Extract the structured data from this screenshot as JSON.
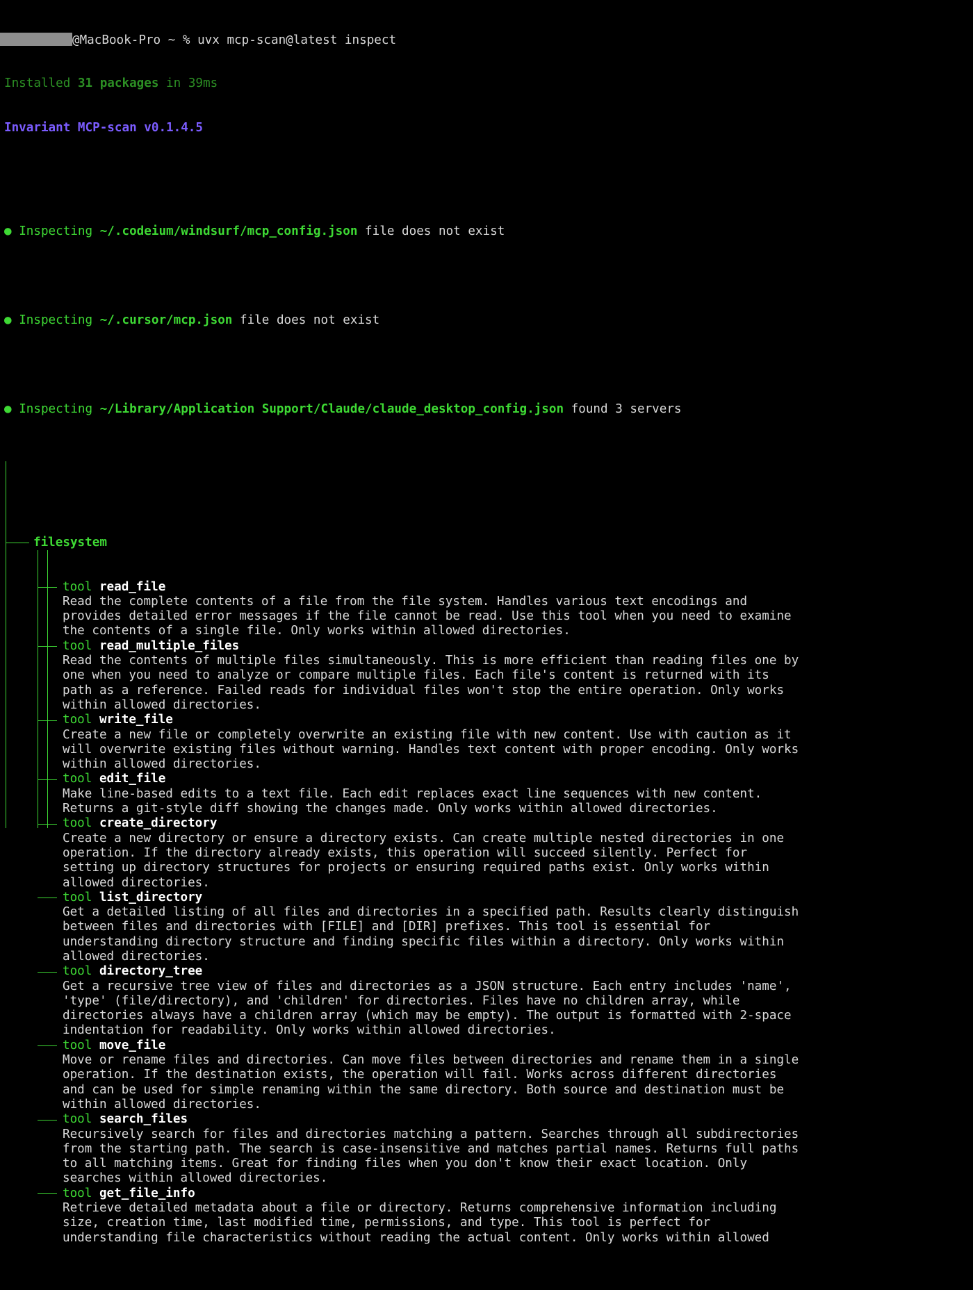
{
  "prompt": {
    "host": "@MacBook-Pro ~ % ",
    "command": "uvx mcp-scan@latest inspect"
  },
  "install_line": {
    "prefix": "Installed ",
    "count": "31 packages",
    "suffix": " in 39ms"
  },
  "version_line": "Invariant MCP-scan v0.1.4.5",
  "inspections": [
    {
      "bullet": "●",
      "label": "Inspecting",
      "path": "~/.codeium/windsurf/mcp_config.json",
      "status": "file does not exist"
    },
    {
      "bullet": "●",
      "label": "Inspecting",
      "path": "~/.cursor/mcp.json",
      "status": "file does not exist"
    },
    {
      "bullet": "●",
      "label": "Inspecting",
      "path": "~/Library/Application Support/Claude/claude_desktop_config.json",
      "status": "found 3 servers"
    }
  ],
  "server": {
    "name": "filesystem",
    "tool_keyword": "tool",
    "tools": [
      {
        "name": "read_file",
        "desc": [
          "Read the complete contents of a file from the file system. Handles various text encodings and",
          "provides detailed error messages if the file cannot be read. Use this tool when you need to examine",
          "the contents of a single file. Only works within allowed directories."
        ]
      },
      {
        "name": "read_multiple_files",
        "desc": [
          "Read the contents of multiple files simultaneously. This is more efficient than reading files one by",
          "one when you need to analyze or compare multiple files. Each file's content is returned with its",
          "path as a reference. Failed reads for individual files won't stop the entire operation. Only works",
          "within allowed directories."
        ]
      },
      {
        "name": "write_file",
        "desc": [
          "Create a new file or completely overwrite an existing file with new content. Use with caution as it",
          "will overwrite existing files without warning. Handles text content with proper encoding. Only works",
          "within allowed directories."
        ]
      },
      {
        "name": "edit_file",
        "desc": [
          "Make line-based edits to a text file. Each edit replaces exact line sequences with new content.",
          "Returns a git-style diff showing the changes made. Only works within allowed directories."
        ]
      },
      {
        "name": "create_directory",
        "desc": [
          "Create a new directory or ensure a directory exists. Can create multiple nested directories in one",
          "operation. If the directory already exists, this operation will succeed silently. Perfect for",
          "setting up directory structures for projects or ensuring required paths exist. Only works within",
          "allowed directories."
        ]
      },
      {
        "name": "list_directory",
        "desc": [
          "Get a detailed listing of all files and directories in a specified path. Results clearly distinguish",
          "between files and directories with [FILE] and [DIR] prefixes. This tool is essential for",
          "understanding directory structure and finding specific files within a directory. Only works within",
          "allowed directories."
        ]
      },
      {
        "name": "directory_tree",
        "desc": [
          "Get a recursive tree view of files and directories as a JSON structure. Each entry includes 'name',",
          "'type' (file/directory), and 'children' for directories. Files have no children array, while",
          "directories always have a children array (which may be empty). The output is formatted with 2-space",
          "indentation for readability. Only works within allowed directories."
        ]
      },
      {
        "name": "move_file",
        "desc": [
          "Move or rename files and directories. Can move files between directories and rename them in a single",
          "operation. If the destination exists, the operation will fail. Works across different directories",
          "and can be used for simple renaming within the same directory. Both source and destination must be",
          "within allowed directories."
        ]
      },
      {
        "name": "search_files",
        "desc": [
          "Recursively search for files and directories matching a pattern. Searches through all subdirectories",
          "from the starting path. The search is case-insensitive and matches partial names. Returns full paths",
          "to all matching items. Great for finding files when you don't know their exact location. Only",
          "searches within allowed directories."
        ]
      },
      {
        "name": "get_file_info",
        "desc": [
          "Retrieve detailed metadata about a file or directory. Returns comprehensive information including",
          "size, creation time, last modified time, permissions, and type. This tool is perfect for",
          "understanding file characteristics without reading the actual content. Only works within allowed"
        ]
      }
    ]
  },
  "colors": {
    "background": "#000000",
    "text": "#d9d9d9",
    "green": "#3ed934",
    "green_dim": "#2c8f24",
    "purple": "#7b5cff",
    "mask": "#8e8e8e"
  }
}
